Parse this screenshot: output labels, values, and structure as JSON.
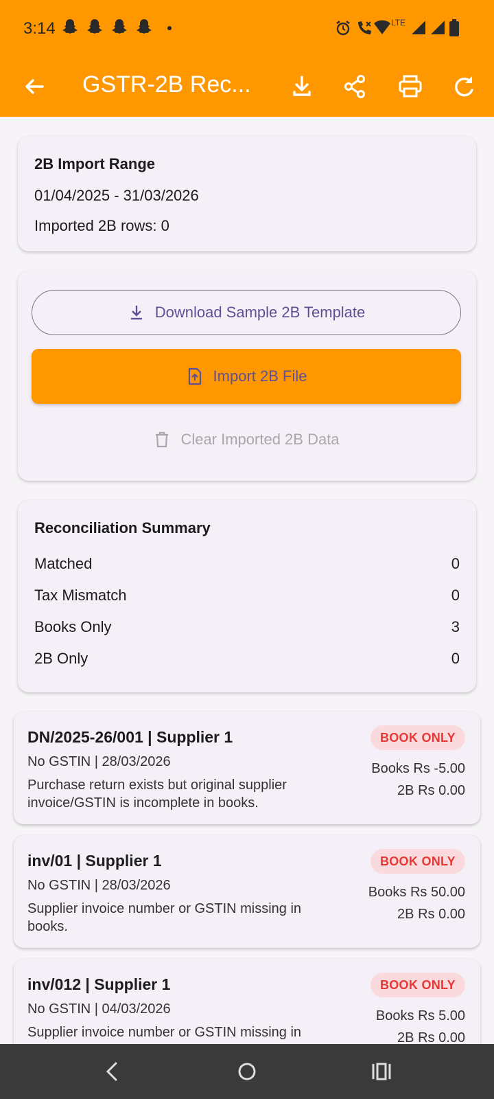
{
  "status_bar": {
    "time": "3:14",
    "icons": [
      "snapchat-icon",
      "snapchat-icon",
      "snapchat-icon",
      "snapchat-icon",
      "alarm-icon",
      "wifi-calling-icon",
      "wifi-icon",
      "lte-signal-icon",
      "signal-icon",
      "battery-icon"
    ],
    "network_label": "LTE"
  },
  "app_bar": {
    "title": "GSTR-2B Rec...",
    "background": "#ff9800",
    "actions": [
      "download-icon",
      "share-icon",
      "print-icon",
      "refresh-icon"
    ]
  },
  "import_range": {
    "heading": "2B Import Range",
    "range": "01/04/2025 - 31/03/2026",
    "imported_rows": "Imported 2B rows: 0"
  },
  "actions": {
    "download_template": "Download Sample 2B Template",
    "import_file": "Import 2B File",
    "clear_data": "Clear Imported 2B Data"
  },
  "summary": {
    "heading": "Reconciliation Summary",
    "rows": [
      {
        "label": "Matched",
        "value": "0"
      },
      {
        "label": "Tax Mismatch",
        "value": "0"
      },
      {
        "label": "Books Only",
        "value": "3"
      },
      {
        "label": "2B Only",
        "value": "0"
      }
    ]
  },
  "entries": [
    {
      "title": "DN/2025-26/001 | Supplier 1",
      "details": "No GSTIN | 28/03/2026",
      "note": "Purchase return exists but original supplier invoice/GSTIN is incomplete in books.",
      "badge": "BOOK ONLY",
      "books_amount": "Books Rs -5.00",
      "twob_amount": "2B Rs 0.00"
    },
    {
      "title": "inv/01 | Supplier 1",
      "details": "No GSTIN | 28/03/2026",
      "note": "Supplier invoice number or GSTIN missing in books.",
      "badge": "BOOK ONLY",
      "books_amount": "Books Rs 50.00",
      "twob_amount": "2B Rs 0.00"
    },
    {
      "title": "inv/012 | Supplier 1",
      "details": "No GSTIN | 04/03/2026",
      "note": "Supplier invoice number or GSTIN missing in books.",
      "badge": "BOOK ONLY",
      "books_amount": "Books Rs 5.00",
      "twob_amount": "2B Rs 0.00"
    }
  ],
  "nav_bar": [
    "back-nav-icon",
    "home-nav-icon",
    "recents-nav-icon"
  ]
}
